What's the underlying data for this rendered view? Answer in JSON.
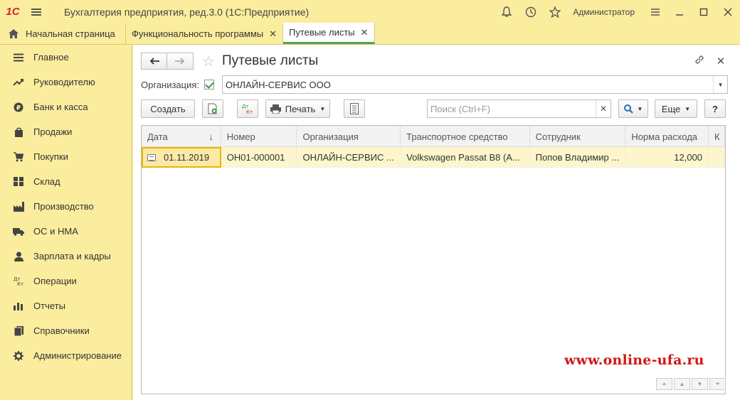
{
  "titlebar": {
    "logo": "1С",
    "app_title": "Бухгалтерия предприятия, ред.3.0  (1С:Предприятие)",
    "user": "Администратор",
    "icons": [
      "bell-icon",
      "history-icon",
      "star-icon",
      "settings-icon"
    ]
  },
  "tabs": {
    "home": "Начальная страница",
    "items": [
      {
        "label": "Функциональность программы",
        "close": "✕"
      },
      {
        "label": "Путевые листы",
        "close": "✕"
      }
    ]
  },
  "sidebar": {
    "items": [
      {
        "label": "Главное",
        "icon": "menu-icon"
      },
      {
        "label": "Руководителю",
        "icon": "trend-icon"
      },
      {
        "label": "Банк и касса",
        "icon": "coin-icon"
      },
      {
        "label": "Продажи",
        "icon": "bag-icon"
      },
      {
        "label": "Покупки",
        "icon": "cart-icon"
      },
      {
        "label": "Склад",
        "icon": "warehouse-icon"
      },
      {
        "label": "Производство",
        "icon": "factory-icon"
      },
      {
        "label": "ОС и НМА",
        "icon": "truck-icon"
      },
      {
        "label": "Зарплата и кадры",
        "icon": "person-icon"
      },
      {
        "label": "Операции",
        "icon": "dt-kt-icon"
      },
      {
        "label": "Отчеты",
        "icon": "chart-icon"
      },
      {
        "label": "Справочники",
        "icon": "book-icon"
      },
      {
        "label": "Администрирование",
        "icon": "gear-icon"
      }
    ]
  },
  "form": {
    "title": "Путевые листы",
    "org_label": "Организация:",
    "org_value": "ОНЛАЙН-СЕРВИС ООО",
    "toolbar": {
      "create": "Создать",
      "print": "Печать",
      "more": "Еще",
      "help": "?",
      "search_placeholder": "Поиск (Ctrl+F)",
      "dtkt": "Дт Кт"
    },
    "table": {
      "columns": [
        "Дата",
        "Номер",
        "Организация",
        "Транспортное средство",
        "Сотрудник",
        "Норма расхода",
        "К"
      ],
      "rows": [
        [
          "01.11.2019",
          "ОН01-000001",
          "ОНЛАЙН-СЕРВИС ...",
          "Volkswagen Passat B8 (А...",
          "Попов Владимир ...",
          "12,000",
          ""
        ]
      ]
    }
  },
  "watermark": "www.online-ufa.ru"
}
